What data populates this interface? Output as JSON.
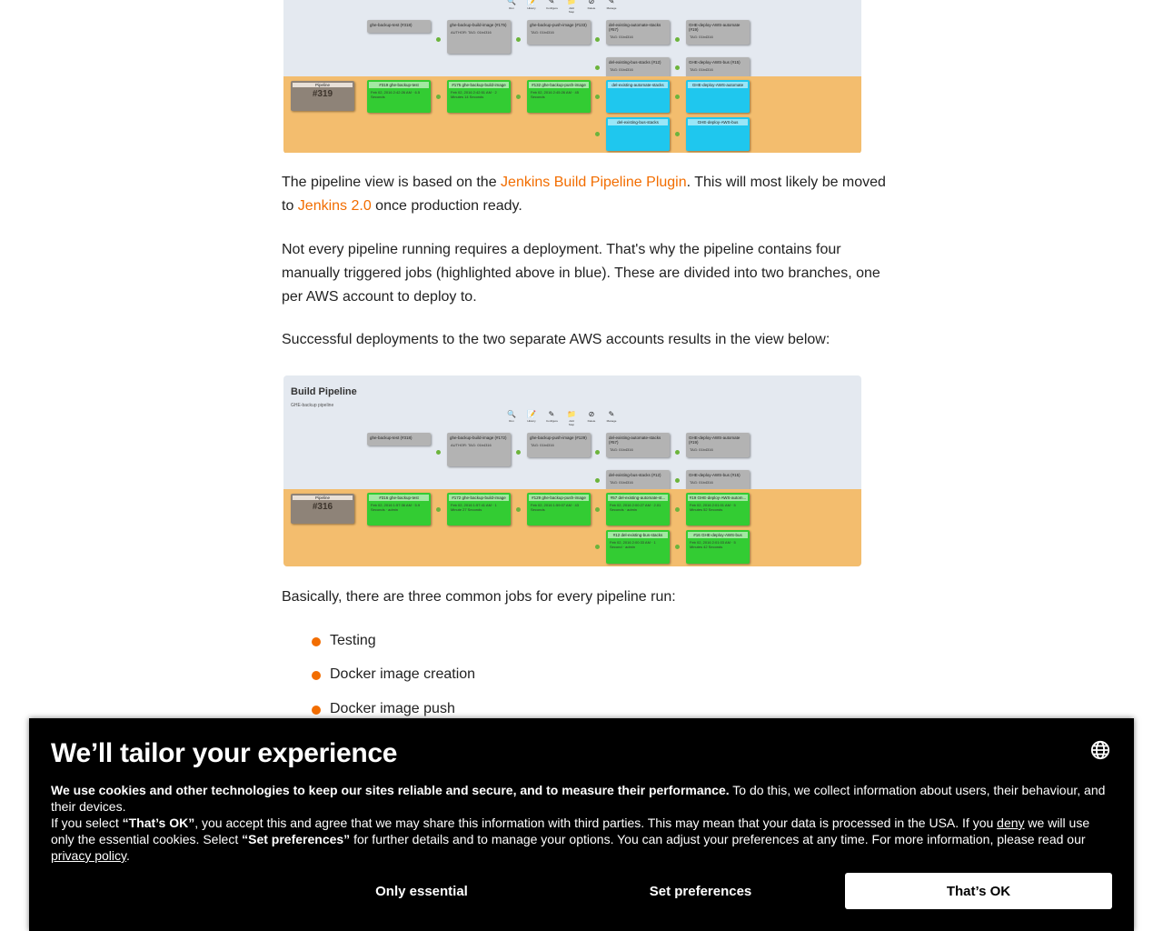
{
  "pipeline_images": [
    {
      "title": "",
      "subtitle": "",
      "toolbar": [
        "Run",
        "History",
        "Configure",
        "Add Step",
        "Delete",
        "Manage"
      ],
      "pipeline_label": "Pipeline",
      "pipeline_number": "#319",
      "upstream_row1": [
        {
          "title": "ghe-backup-test (#318)",
          "sub": ""
        },
        {
          "title": "ghe-backup-build-image (#175)",
          "sub": "AUTHOR: TAG: 01b4316"
        },
        {
          "title": "ghe-backup-push-image (#133)",
          "sub": "TAG: 01b4316"
        },
        {
          "title": "del-existing-automate-stacks (#57)",
          "sub": "TAG: 01b4316"
        },
        {
          "title": "GHE-deploy-AWS-automate (#19)",
          "sub": "TAG: 01b4316"
        }
      ],
      "upstream_row2": [
        {
          "title": "del-existing-bus-stacks (#12)",
          "sub": "TAG: 01b4316"
        },
        {
          "title": "GHE-deploy-AWS-bus (#15)",
          "sub": "TAG: 01b4316"
        }
      ],
      "run_row1": [
        {
          "title": "#319 ghe-backup-test",
          "sub": "Feb 02, 2016 2:42:26 AM · 6.5 Seconds",
          "status": "green"
        },
        {
          "title": "#175 ghe-backup-build-image",
          "sub": "Feb 02, 2016 2:42:51 AM · 2 Minutes 14 Seconds",
          "status": "green"
        },
        {
          "title": "#132 ghe-backup-push-image",
          "sub": "Feb 02, 2016 2:45:26 AM · 45 Seconds",
          "status": "green"
        },
        {
          "title": "del-existing-automate-stacks",
          "sub": "",
          "status": "blue"
        },
        {
          "title": "GHE-deploy-AWS-automate",
          "sub": "",
          "status": "blue"
        }
      ],
      "run_row2": [
        {
          "title": "del-existing-bus-stacks",
          "sub": "",
          "status": "blue"
        },
        {
          "title": "GHE-deploy-AWS-bus",
          "sub": "",
          "status": "blue"
        }
      ]
    },
    {
      "title": "Build Pipeline",
      "subtitle": "GHE-backup pipeline",
      "toolbar": [
        "Run",
        "History",
        "Configure",
        "Add Step",
        "Delete",
        "Manage"
      ],
      "pipeline_label": "Pipeline",
      "pipeline_number": "#316",
      "upstream_row1": [
        {
          "title": "ghe-backup-test (#318)",
          "sub": ""
        },
        {
          "title": "ghe-backup-build-image (#172)",
          "sub": "AUTHOR: TAG: 01b4316"
        },
        {
          "title": "ghe-backup-push-image (#129)",
          "sub": "TAG: 01b4316"
        },
        {
          "title": "del-existing-automate-stacks (#57)",
          "sub": "TAG: 01b4316"
        },
        {
          "title": "GHE-deploy-AWS-automate (#19)",
          "sub": "TAG: 01b4316"
        }
      ],
      "upstream_row2": [
        {
          "title": "del-existing-bus-stacks (#12)",
          "sub": "TAG: 01b4316"
        },
        {
          "title": "GHE-deploy-AWS-bus (#15)",
          "sub": "TAG: 01b4316"
        }
      ],
      "run_row1": [
        {
          "title": "#316 ghe-backup-test",
          "sub": "Feb 02, 2016 1:57:36 AM · 5.9 Seconds · admin",
          "status": "green"
        },
        {
          "title": "#172 ghe-backup-build-image",
          "sub": "Feb 02, 2016 1:57:41 AM · 1 Minute 27 Seconds",
          "status": "green"
        },
        {
          "title": "#129 ghe-backup-push-image",
          "sub": "Feb 02, 2016 1:59:07 AM · 43 Seconds",
          "status": "green"
        },
        {
          "title": "#57 del-existing-automate-st...",
          "sub": "Feb 02, 2016 2:00:27 AM · 2.01 Seconds · admin",
          "status": "green"
        },
        {
          "title": "#19 GHE-deploy-AWS-autom...",
          "sub": "Feb 02, 2016 2:01:01 AM · 5 Minutes 52 Seconds",
          "status": "green"
        }
      ],
      "run_row2": [
        {
          "title": "#12 del-existing-bus-stacks",
          "sub": "Feb 02, 2016 2:00:33 AM · 1 Second · admin",
          "status": "green"
        },
        {
          "title": "#16 GHE-deploy-AWS-bus",
          "sub": "Feb 02, 2016 2:01:03 AM · 5 Minutes 42 Seconds",
          "status": "green"
        }
      ]
    }
  ],
  "article": {
    "p1_before": "The pipeline view is based on the ",
    "p1_link1": "Jenkins Build Pipeline Plugin",
    "p1_mid": ". This will most likely be moved to ",
    "p1_link2": "Jenkins 2.0",
    "p1_after": " once production ready.",
    "p2": "Not every pipeline running requires a deployment. That's why the pipeline contains four manually triggered jobs (highlighted above in blue). These are divided into two branches, one per AWS account to deploy to.",
    "p3": "Successful deployments to the two separate AWS accounts results in the view below:",
    "p4": "Basically, there are three common jobs for every pipeline run:",
    "bullets": [
      "Testing",
      "Docker image creation",
      "Docker image push"
    ],
    "accent_color": "#f26d00"
  },
  "cookie_banner": {
    "title": "We’ll tailor your experience",
    "bold_intro": "We use cookies and other technologies to keep our sites reliable and secure, and to measure their performance.",
    "intro_rest": " To do this, we collect information about users, their behaviour, and their devices.",
    "l2_a": "If you select ",
    "l2_ok": "“That’s OK”",
    "l2_b": ", you accept this and agree that we may share this information with third parties. This may mean that your data is processed in the USA. If you ",
    "l2_deny": "deny",
    "l2_c": " we will use only the essential cookies. Select ",
    "l2_pref": "“Set preferences”",
    "l2_d": " for further details and to manage your options. You can adjust your preferences at any time. For more information, please read our ",
    "privacy_link": "privacy policy",
    "l2_end": ".",
    "only_essential": "Only essential",
    "set_preferences": "Set preferences",
    "thats_ok": "That’s OK",
    "language_icon": "globe-icon"
  }
}
